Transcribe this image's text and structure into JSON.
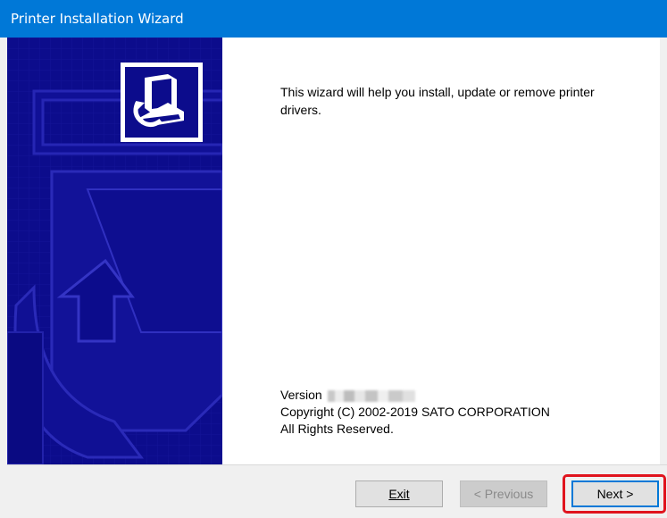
{
  "window": {
    "title": "Printer Installation Wizard"
  },
  "banner": {
    "icon": "printer-wizard-icon",
    "color": "#0c0c8c"
  },
  "content": {
    "intro_text": "This wizard will help you install, update or remove printer drivers.",
    "version_label": "Version",
    "copyright": "Copyright (C) 2002-2019 SATO CORPORATION",
    "rights": "All Rights Reserved."
  },
  "buttons": {
    "exit_label": "Exit",
    "previous_label": "< Previous",
    "next_label": "Next >"
  },
  "colors": {
    "titlebar": "#0078d7",
    "highlight": "#e0141e"
  }
}
